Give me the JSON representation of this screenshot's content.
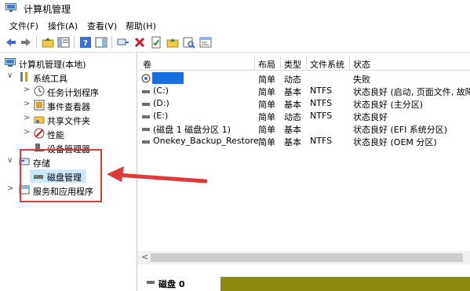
{
  "window": {
    "title": "计算机管理"
  },
  "menu": [
    "文件(F)",
    "操作(A)",
    "查看(V)",
    "帮助(H)"
  ],
  "toolbar": {
    "icons": [
      "back-icon",
      "forward-icon",
      "up-folder-icon",
      "show-tree-icon",
      "help-icon",
      "show-pane-icon",
      "connect-icon",
      "delete-icon",
      "properties-icon",
      "folder-up-icon",
      "search-icon",
      "console-icon"
    ],
    "colors": {
      "delete": "#d11a2a",
      "help": "#3b6fd6"
    }
  },
  "tree": {
    "root": "计算机管理(本地)",
    "system_tools": "系统工具",
    "task_scheduler": "任务计划程序",
    "event_viewer": "事件查看器",
    "shared_folders": "共享文件夹",
    "performance": "性能",
    "device_manager": "设备管理器",
    "storage": "存储",
    "disk_management": "磁盘管理",
    "services_apps": "服务和应用程序"
  },
  "columns": {
    "volume": "卷",
    "layout": "布局",
    "type": "类型",
    "filesystem": "文件系统",
    "status": "状态"
  },
  "volumes": [
    {
      "name": "",
      "layout": "简单",
      "type": "动态",
      "fs": "",
      "status": "失败",
      "redacted": true
    },
    {
      "name": "(C:)",
      "layout": "简单",
      "type": "基本",
      "fs": "NTFS",
      "status": "状态良好 (启动, 页面文件, 故障转"
    },
    {
      "name": "(D:)",
      "layout": "简单",
      "type": "基本",
      "fs": "NTFS",
      "status": "状态良好 (主分区)"
    },
    {
      "name": "(E:)",
      "layout": "简单",
      "type": "动态",
      "fs": "NTFS",
      "status": "状态良好"
    },
    {
      "name": "(磁盘 1 磁盘分区 1)",
      "layout": "简单",
      "type": "基本",
      "fs": "",
      "status": "状态良好 (EFI 系统分区)"
    },
    {
      "name": "Onekey_Backup_Restore",
      "layout": "简单",
      "type": "基本",
      "fs": "NTFS",
      "status": "状态良好 (OEM 分区)"
    }
  ],
  "scroll": {
    "left_arrow": "<"
  },
  "disk": {
    "label": "磁盘 0"
  },
  "annotation": {
    "color": "#e0393a"
  },
  "accent": {
    "selection": "#cce8ff",
    "redaction": "#1a6fe0",
    "disk_bar": "#8b8b0f"
  }
}
